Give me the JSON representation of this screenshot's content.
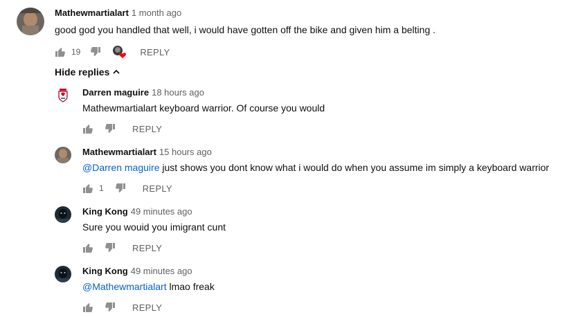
{
  "top_comment": {
    "author": "Mathewmartialart",
    "time": "1 month ago",
    "text": "good god you handled that well, i would have gotten off the bike and given him a belting .",
    "like_count": "19",
    "reply_label": "REPLY"
  },
  "hide_replies_label": "Hide replies",
  "replies": [
    {
      "author": "Darren maguire",
      "time": "18 hours ago",
      "mention": "",
      "text": "Mathewmartialart keyboard warrior. Of course you would",
      "like_count": "",
      "reply_label": "REPLY"
    },
    {
      "author": "Mathewmartialart",
      "time": "15 hours ago",
      "mention": "@Darren maguire",
      "text": " just shows you dont know what i would do when you assume im simply a keyboard warrior",
      "like_count": "1",
      "reply_label": "REPLY"
    },
    {
      "author": "King Kong",
      "time": "49 minutes ago",
      "mention": "",
      "text": "Sure you wouid you imigrant cunt",
      "like_count": "",
      "reply_label": "REPLY"
    },
    {
      "author": "King Kong",
      "time": "49 minutes ago",
      "mention": "@Mathewmartialart",
      "text": " lmao freak",
      "like_count": "",
      "reply_label": "REPLY"
    }
  ],
  "icons": {
    "like": "thumbs-up-icon",
    "dislike": "thumbs-down-icon",
    "creator_heart": "creator-heart-icon",
    "chevron": "chevron-up-icon"
  },
  "colors": {
    "link": "#065fd4",
    "secondary_text": "#606060",
    "icon": "#909090",
    "heart": "#ff0000"
  }
}
